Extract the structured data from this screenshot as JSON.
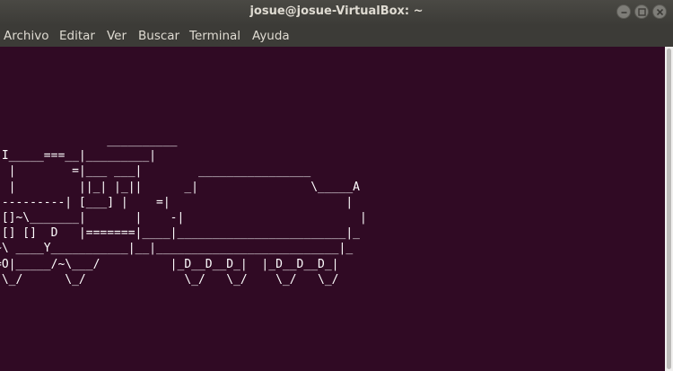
{
  "window": {
    "title": "josue@josue-VirtualBox: ~"
  },
  "controls": {
    "minimize_icon": "minimize-icon",
    "maximize_icon": "maximize-icon",
    "close_icon": "close-icon"
  },
  "menu": {
    "items": [
      {
        "label": "Archivo"
      },
      {
        "label": "Editar"
      },
      {
        "label": "Ver"
      },
      {
        "label": "Buscar"
      },
      {
        "label": "Terminal"
      },
      {
        "label": "Ayuda"
      }
    ]
  },
  "terminal": {
    "lines": [
      "                __________",
      " I_____===__|_________|",
      "  |        =|___ ___|        ________________",
      "  |         ||_| |_||      _|                \\_____A",
      "----------| [___] |    =|                         |",
      " []~\\_______|       |    -|                         |",
      " [] []  D   |=======|____|________________________|_",
      "~\\ ____Y___________|__|__________________________|_",
      "=O|_____/~\\___/          |_D__D__D_|  |_D__D__D_|",
      " \\_/      \\_/              \\_/   \\_/    \\_/   \\_/"
    ]
  },
  "colors": {
    "terminal_background": "#300a24",
    "terminal_text": "#ffffff",
    "titlebar": "#3c3b37"
  }
}
